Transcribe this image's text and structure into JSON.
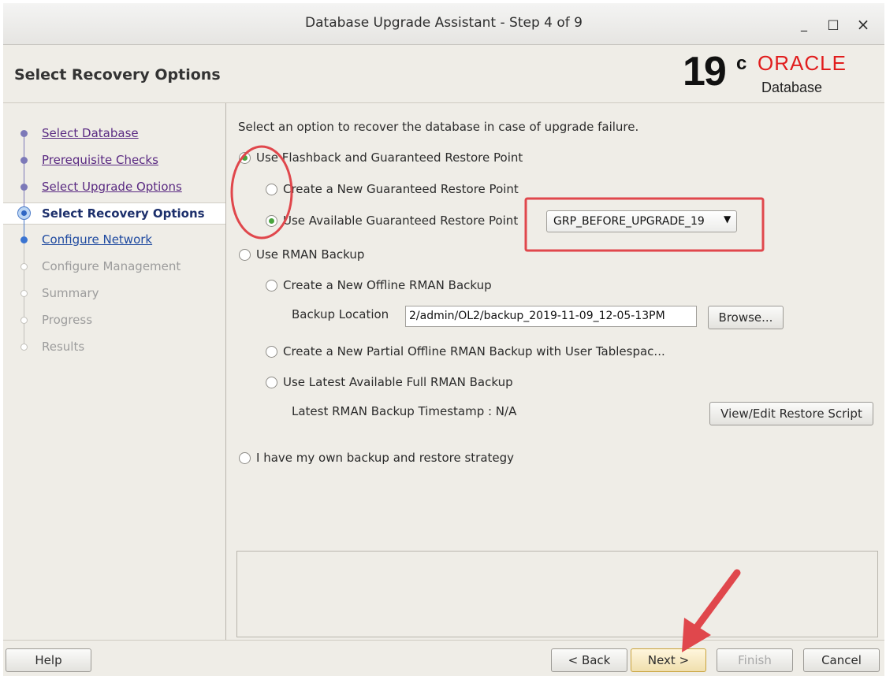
{
  "window": {
    "title": "Database Upgrade Assistant - Step 4 of 9",
    "minimize_glyph": "_",
    "maximize_glyph": "□",
    "close_glyph": "×"
  },
  "header": {
    "title": "Select Recovery Options",
    "logo_version": "19",
    "logo_version_suffix": "c",
    "logo_brand": "ORACLE",
    "logo_product": "Database"
  },
  "sidebar": {
    "steps": [
      {
        "label": "Select Database",
        "state": "done"
      },
      {
        "label": "Prerequisite Checks",
        "state": "done"
      },
      {
        "label": "Select Upgrade Options",
        "state": "done"
      },
      {
        "label": "Select Recovery Options",
        "state": "current"
      },
      {
        "label": "Configure Network",
        "state": "next"
      },
      {
        "label": "Configure Management",
        "state": "disabled"
      },
      {
        "label": "Summary",
        "state": "disabled"
      },
      {
        "label": "Progress",
        "state": "disabled"
      },
      {
        "label": "Results",
        "state": "disabled"
      }
    ]
  },
  "main": {
    "instruction": "Select an option to recover the database in case of upgrade failure.",
    "flashback": {
      "label": "Use Flashback and Guaranteed Restore Point",
      "selected": true,
      "create_new_label": "Create a New Guaranteed Restore Point",
      "create_new_selected": false,
      "use_available_label": "Use Available Guaranteed Restore Point",
      "use_available_selected": true,
      "restore_point_value": "GRP_BEFORE_UPGRADE_19"
    },
    "rman": {
      "label": "Use RMAN Backup",
      "selected": false,
      "offline_label": "Create a New Offline RMAN Backup",
      "backup_location_label": "Backup Location",
      "backup_location_value": "2/admin/OL2/backup_2019-11-09_12-05-13PM",
      "browse_label": "Browse...",
      "partial_label": "Create a New Partial Offline RMAN Backup with User Tablespac...",
      "latest_label": "Use Latest Available Full RMAN Backup",
      "timestamp_label": "Latest RMAN Backup Timestamp : N/A",
      "view_edit_label": "View/Edit Restore Script"
    },
    "own_backup": {
      "label": "I have my own backup and restore strategy",
      "selected": false
    }
  },
  "footer": {
    "help_label": "Help",
    "back_label": "< Back",
    "next_label": "Next >",
    "finish_label": "Finish",
    "cancel_label": "Cancel"
  },
  "annotations": {
    "highlight_color": "#e0474c"
  }
}
